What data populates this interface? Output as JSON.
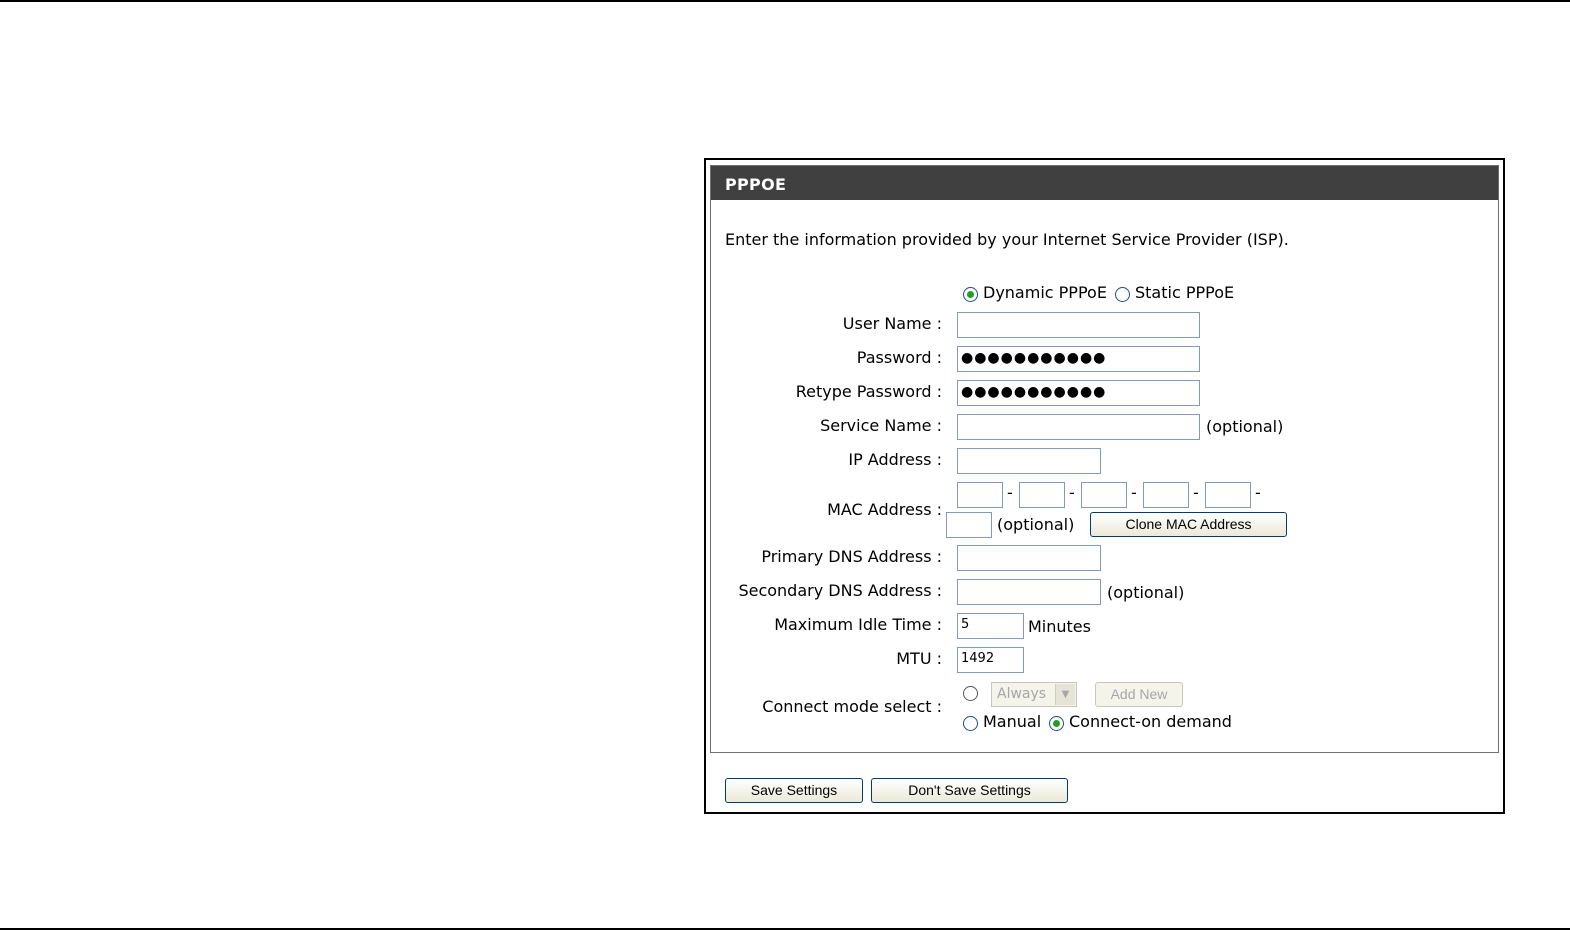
{
  "section": {
    "title": "PPPOE",
    "intro": "Enter the information provided by your Internet Service Provider (ISP)."
  },
  "mode": {
    "dynamic_label": "Dynamic PPPoE",
    "static_label": "Static PPPoE",
    "selected": "dynamic"
  },
  "fields": {
    "user_name_label": "User Name :",
    "user_name_value": "",
    "password_label": "Password :",
    "password_value": "●●●●●●●●●●●",
    "retype_password_label": "Retype Password :",
    "retype_password_value": "●●●●●●●●●●●",
    "service_name_label": "Service Name :",
    "service_name_value": "",
    "ip_address_label": "IP Address :",
    "ip_address_value": "",
    "mac_address_label": "MAC Address :",
    "mac_octets": [
      "",
      "",
      "",
      "",
      "",
      ""
    ],
    "mac_separator": "-",
    "primary_dns_label": "Primary DNS Address :",
    "primary_dns_value": "",
    "secondary_dns_label": "Secondary DNS Address :",
    "secondary_dns_value": "",
    "idle_time_label": "Maximum Idle Time :",
    "idle_time_value": "5",
    "idle_time_unit": "Minutes",
    "mtu_label": "MTU :",
    "mtu_value": "1492",
    "optional_text": "(optional)"
  },
  "clone_mac_button": "Clone MAC Address",
  "connect_mode": {
    "label": "Connect mode select :",
    "schedule_select": "Always",
    "add_new_button": "Add New",
    "manual_label": "Manual",
    "on_demand_label": "Connect-on demand",
    "selected": "on_demand"
  },
  "buttons": {
    "save": "Save Settings",
    "dont_save": "Don't Save Settings"
  }
}
